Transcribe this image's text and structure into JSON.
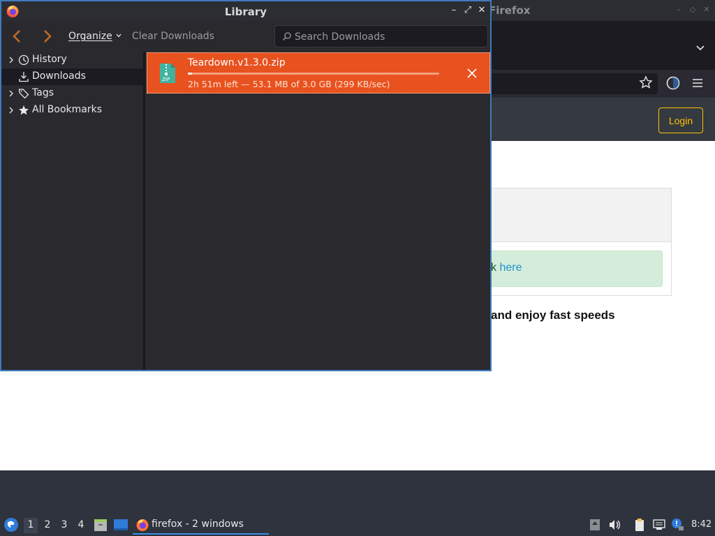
{
  "firefox": {
    "title": "Firefox",
    "login_label": "Login",
    "alert_text_visible": "k ",
    "alert_link": "here",
    "tagline_visible": "and enjoy fast speeds"
  },
  "library": {
    "title": "Library",
    "toolbar": {
      "organize_label": "Organize",
      "clear_downloads_label": "Clear Downloads",
      "search_placeholder": "Search Downloads"
    },
    "sidebar": {
      "items": [
        {
          "label": "History",
          "icon": "clock-icon",
          "expandable": true
        },
        {
          "label": "Downloads",
          "icon": "download-icon",
          "expandable": false,
          "selected": true
        },
        {
          "label": "Tags",
          "icon": "tag-icon",
          "expandable": true
        },
        {
          "label": "All Bookmarks",
          "icon": "star-icon",
          "expandable": true
        }
      ]
    },
    "downloads": [
      {
        "filename": "Teardown.v1.3.0.zip",
        "status": "2h 51m left — 53.1 MB of 3.0 GB (299 KB/sec)",
        "progress_fraction": 0.0177,
        "icon": "zip-file-icon"
      }
    ]
  },
  "taskbar": {
    "workspaces": [
      "1",
      "2",
      "3",
      "4"
    ],
    "active_workspace": "1",
    "task_label": "firefox - 2 windows",
    "clock": "8:42"
  },
  "colors": {
    "accent_download": "#e8521f",
    "window_border": "#3f7bbf",
    "login_outline": "#ffc107",
    "taskbar_bg": "#2e333d"
  }
}
